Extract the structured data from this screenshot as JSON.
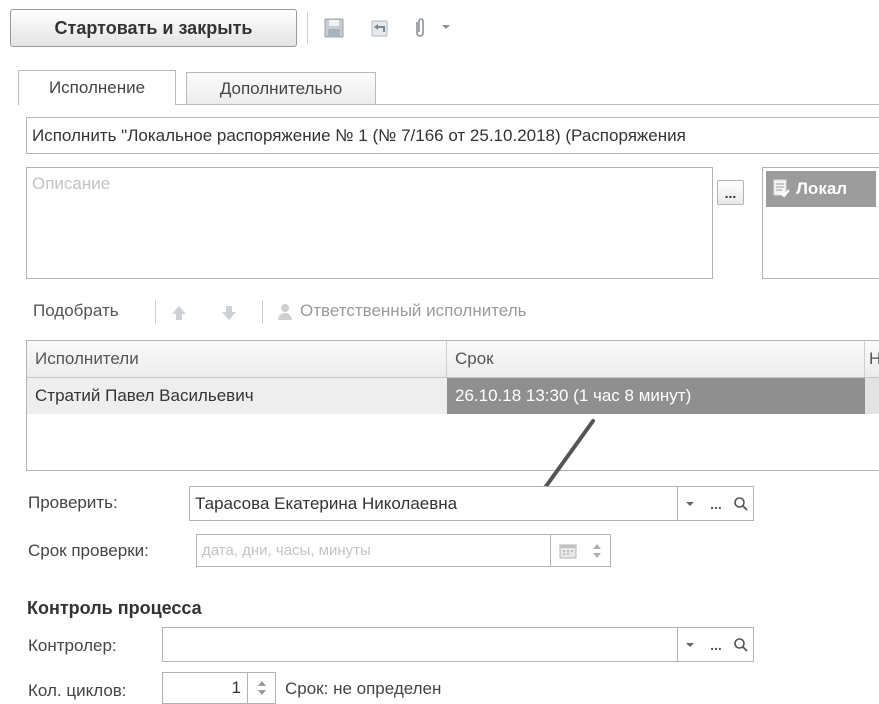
{
  "toolbar": {
    "start_close_label": "Стартовать и закрыть",
    "icons": [
      "save-icon",
      "undo-icon",
      "paperclip-icon",
      "dropdown-arrow-icon"
    ]
  },
  "tabs": [
    {
      "label": "Исполнение",
      "active": true
    },
    {
      "label": "Дополнительно",
      "active": false
    }
  ],
  "task": {
    "name_value": "Исполнить \"Локальное распоряжение № 1 (№ 7/166 от 25.10.2018) (Распоряжения",
    "description_placeholder": "Описание",
    "description_button": "...",
    "attachment_label": "Локал"
  },
  "performers_toolbar": {
    "pick_label": "Подобрать",
    "responsible_label": "Ответственный исполнитель"
  },
  "performers_table": {
    "columns": [
      "Исполнители",
      "Срок",
      "Н"
    ],
    "rows": [
      {
        "performer": "Стратий Павел Васильевич",
        "deadline": "26.10.18 13:30 (1 час 8 минут)"
      }
    ]
  },
  "check": {
    "label": "Проверить:",
    "value": "Тарасова Екатерина Николаевна",
    "deadline_label": "Срок проверки:",
    "deadline_placeholder": "дата, дни, часы, минуты"
  },
  "control": {
    "section_title": "Контроль процесса",
    "controller_label": "Контролер:",
    "controller_value": "",
    "cycles_label": "Кол. циклов:",
    "cycles_value": "1",
    "term_text": "Срок: не определен"
  },
  "colors": {
    "selected_cell": "#8f8f8f",
    "arrow": "#555555"
  }
}
